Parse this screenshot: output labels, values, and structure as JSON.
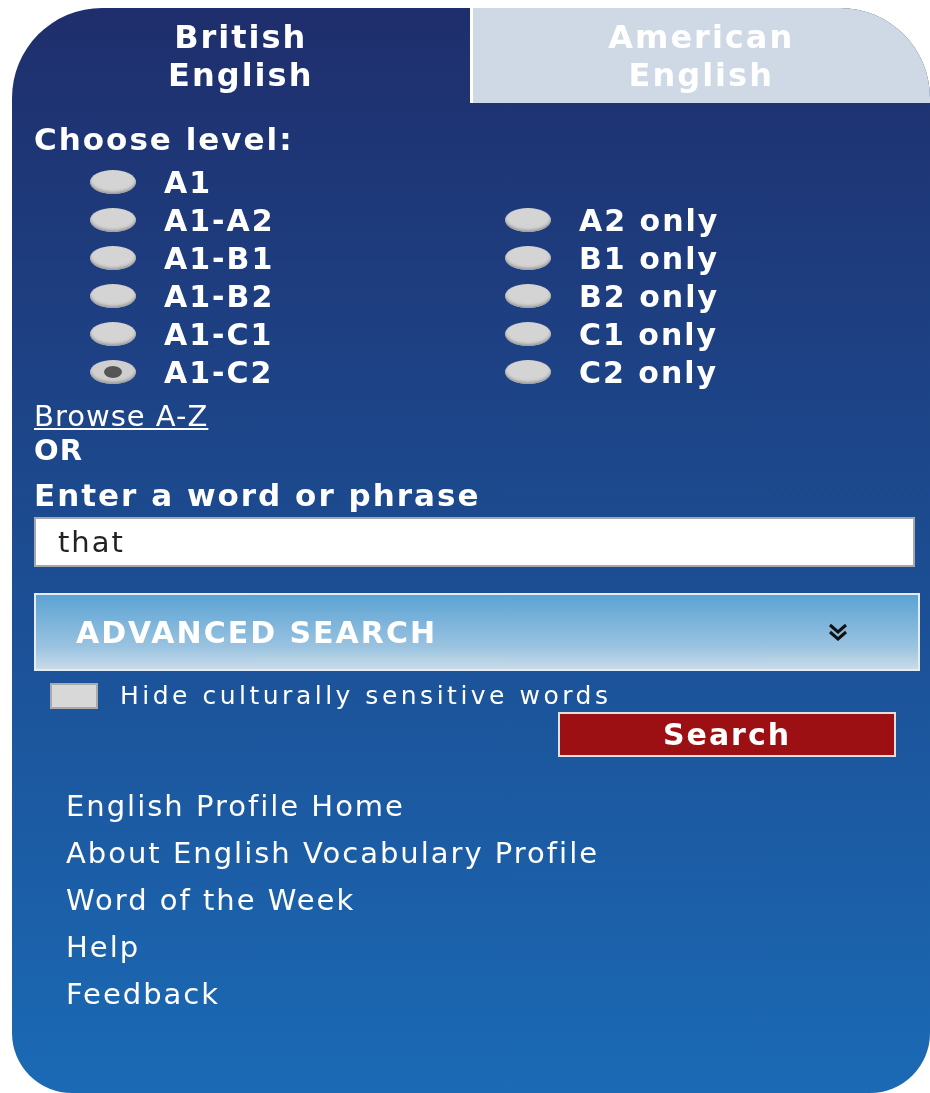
{
  "tabs": [
    {
      "label": "British English",
      "selected": true
    },
    {
      "label": "American English",
      "selected": false
    }
  ],
  "level": {
    "label": "Choose level:",
    "left_options": [
      {
        "label": "A1",
        "selected": false
      },
      {
        "label": "A1-A2",
        "selected": false
      },
      {
        "label": "A1-B1",
        "selected": false
      },
      {
        "label": "A1-B2",
        "selected": false
      },
      {
        "label": "A1-C1",
        "selected": false
      },
      {
        "label": "A1-C2",
        "selected": true
      }
    ],
    "right_options": [
      {
        "label": "A2 only",
        "selected": false
      },
      {
        "label": "B1 only",
        "selected": false
      },
      {
        "label": "B2 only",
        "selected": false
      },
      {
        "label": "C1 only",
        "selected": false
      },
      {
        "label": "C2 only",
        "selected": false
      }
    ]
  },
  "browse_link": "Browse A-Z",
  "or_label": "OR",
  "search": {
    "label": "Enter a word or phrase",
    "value": "that"
  },
  "advanced_search": {
    "label": "ADVANCED SEARCH",
    "expanded": false
  },
  "hide_sensitive": {
    "label": "Hide culturally sensitive words",
    "checked": false
  },
  "search_button": "Search",
  "links": [
    "English Profile Home",
    "About English Vocabulary Profile",
    "Word of the Week",
    "Help",
    "Feedback"
  ]
}
